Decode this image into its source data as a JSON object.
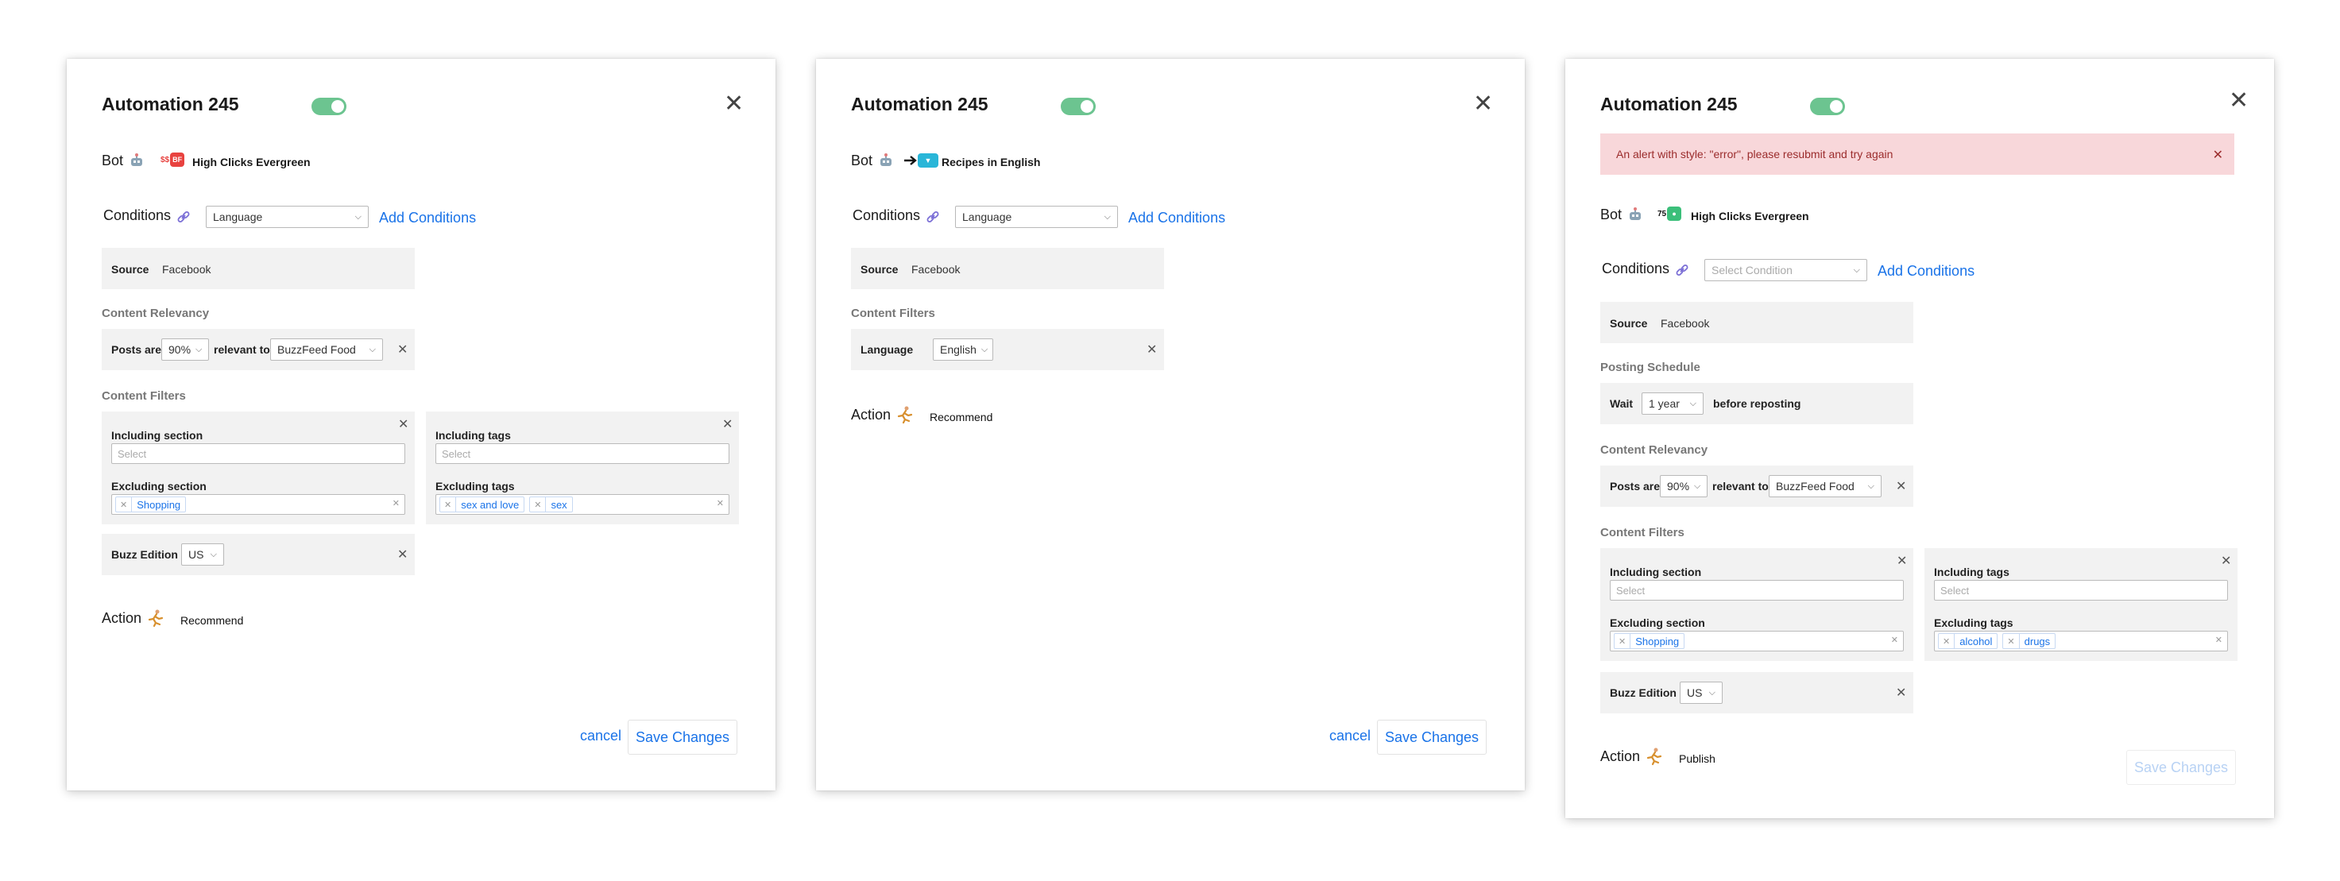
{
  "modals": [
    {
      "title": "Automation 245",
      "bot_label": "Bot",
      "bot_badge": "$$BF",
      "bot_name": "High Clicks Evergreen",
      "conditions_label": "Conditions",
      "conditions_select": "Language",
      "add_conditions": "Add Conditions",
      "source_label": "Source",
      "source_value": "Facebook",
      "relevancy_head": "Content Relevancy",
      "posts_are": "Posts are",
      "percent": "90%",
      "relevant_to": "relevant to",
      "relevant_target": "BuzzFeed Food",
      "filters_head": "Content Filters",
      "including_section": "Including section",
      "including_section_placeholder": "Select",
      "excluding_section": "Excluding section",
      "excluding_section_tags": [
        "Shopping"
      ],
      "including_tags": "Including tags",
      "including_tags_placeholder": "Select",
      "excluding_tags": "Excluding tags",
      "excluding_tags_tags": [
        "sex and love",
        "sex"
      ],
      "edition_label": "Buzz Edition",
      "edition_value": "US",
      "action_label": "Action",
      "action_value": "Recommend",
      "cancel": "cancel",
      "save": "Save Changes"
    },
    {
      "title": "Automation 245",
      "bot_label": "Bot",
      "bot_name": "Recipes in English",
      "conditions_label": "Conditions",
      "conditions_select": "Language",
      "add_conditions": "Add Conditions",
      "source_label": "Source",
      "source_value": "Facebook",
      "filters_head": "Content Filters",
      "language_label": "Language",
      "language_value": "English",
      "action_label": "Action",
      "action_value": "Recommend",
      "cancel": "cancel",
      "save": "Save Changes"
    },
    {
      "title": "Automation 245",
      "alert": "An alert with style: \"error\", please resubmit and try again",
      "bot_label": "Bot",
      "bot_badge": "75",
      "bot_name": "High Clicks Evergreen",
      "conditions_label": "Conditions",
      "conditions_placeholder": "Select Condition",
      "add_conditions": "Add Conditions",
      "source_label": "Source",
      "source_value": "Facebook",
      "schedule_head": "Posting Schedule",
      "wait": "Wait",
      "wait_value": "1 year",
      "before_reposting": "before reposting",
      "relevancy_head": "Content Relevancy",
      "posts_are": "Posts are",
      "percent": "90%",
      "relevant_to": "relevant to",
      "relevant_target": "BuzzFeed Food",
      "filters_head": "Content Filters",
      "including_section": "Including section",
      "including_section_placeholder": "Select",
      "excluding_section": "Excluding section",
      "excluding_section_tags": [
        "Shopping"
      ],
      "including_tags": "Including tags",
      "including_tags_placeholder": "Select",
      "excluding_tags": "Excluding tags",
      "excluding_tags_tags": [
        "alcohol",
        "drugs"
      ],
      "edition_label": "Buzz Edition",
      "edition_value": "US",
      "action_label": "Action",
      "action_value": "Publish",
      "save": "Save Changes"
    }
  ],
  "colors": {
    "toggle_on": "#6cc490",
    "link_blue": "#1a73e8",
    "panel_bg": "#f2f2f2",
    "alert_bg": "#f8d7da",
    "alert_text": "#9b2c2c",
    "badge_red": "#e8423f",
    "badge_cyan": "#29b6d8",
    "badge_green": "#3bbf7a"
  },
  "icons": [
    "robot-icon",
    "link-icon",
    "runner-icon",
    "close-icon",
    "chevron-down-icon",
    "arrow-right-icon"
  ]
}
